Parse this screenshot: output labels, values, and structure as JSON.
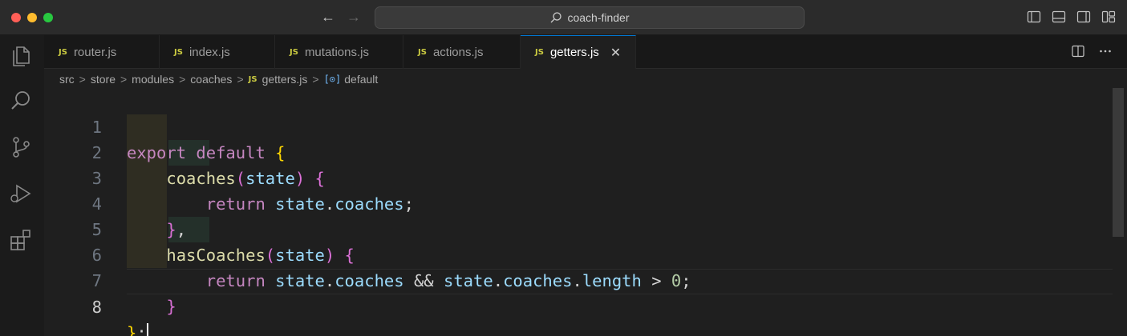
{
  "window": {
    "title": "coach-finder"
  },
  "colors": {
    "accent": "#0078d4",
    "js_badge": "#cbcb41"
  },
  "tabs": [
    {
      "badge": "JS",
      "label": "router.js"
    },
    {
      "badge": "JS",
      "label": "index.js"
    },
    {
      "badge": "JS",
      "label": "mutations.js"
    },
    {
      "badge": "JS",
      "label": "actions.js"
    },
    {
      "badge": "JS",
      "label": "getters.js",
      "close": "✕"
    }
  ],
  "breadcrumb": {
    "parts": [
      "src",
      "store",
      "modules",
      "coaches"
    ],
    "file_badge": "JS",
    "file": "getters.js",
    "symbol_icon": "[⊙]",
    "symbol": "default",
    "separator": ">"
  },
  "editor": {
    "line_numbers": [
      "1",
      "2",
      "3",
      "4",
      "5",
      "6",
      "7",
      "8"
    ],
    "lines": {
      "l1": {
        "export": "export",
        "default": "default",
        "brace": "{"
      },
      "l2": {
        "name": "coaches",
        "popen": "(",
        "param": "state",
        "pclose": ")",
        "brace": "{"
      },
      "l3": {
        "ret": "return",
        "obj": "state",
        "dot": ".",
        "prop": "coaches",
        "semi": ";"
      },
      "l4": {
        "brace": "}",
        "comma": ","
      },
      "l5": {
        "name": "hasCoaches",
        "popen": "(",
        "param": "state",
        "pclose": ")",
        "brace": "{"
      },
      "l6": {
        "ret": "return",
        "obj": "state",
        "dot1": ".",
        "prop": "coaches",
        "and": "&&",
        "obj2": "state",
        "dot2": ".",
        "prop2": "coaches",
        "dot3": ".",
        "len": "length",
        "gt": ">",
        "zero": "0",
        "semi": ";"
      },
      "l7": {
        "brace": "}"
      },
      "l8": {
        "brace": "}",
        "semi": ";"
      }
    }
  }
}
